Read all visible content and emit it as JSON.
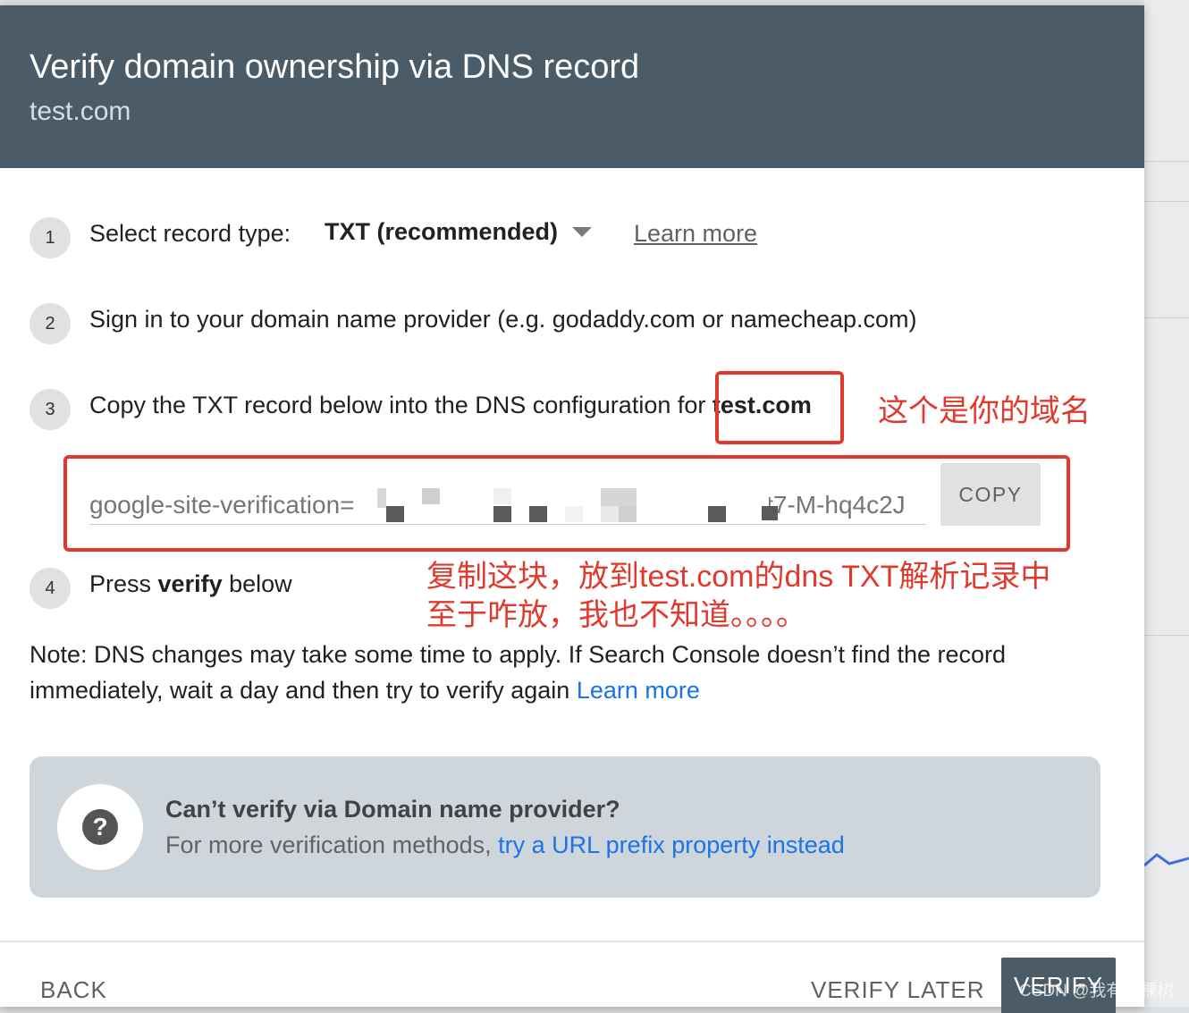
{
  "dialog": {
    "title": "Verify domain ownership via DNS record",
    "subtitle": "test.com"
  },
  "steps": [
    {
      "number": "1",
      "label": "Select record type:"
    },
    {
      "number": "2",
      "label": "Sign in to your domain name provider (e.g. godaddy.com or namecheap.com)"
    },
    {
      "number": "3",
      "label": "Copy the TXT record below into the DNS configuration for ",
      "domain": "test.com"
    },
    {
      "number": "4",
      "label_pre": "Press ",
      "label_bold": "verify",
      "label_post": " below"
    }
  ],
  "record_type": {
    "selected": "TXT (recommended)",
    "learn_more": "Learn more"
  },
  "txt_record": {
    "prefix": "google-site-verification=",
    "visible_suffix": "3t7-M-hq4c2J",
    "copy_label": "COPY"
  },
  "note": {
    "text": "Note: DNS changes may take some time to apply. If Search Console doesn’t find the record immediately, wait a day and then try to verify again ",
    "link": "Learn more"
  },
  "help": {
    "icon": "question-icon",
    "title": "Can’t verify via Domain name provider?",
    "body": "For more verification methods, ",
    "link": "try a URL prefix property instead"
  },
  "footer": {
    "back": "BACK",
    "verify_later": "VERIFY LATER",
    "verify": "VERIFY"
  },
  "annotations": {
    "domain_note": "这个是你的域名",
    "copy_note_line1": "复制这块，放到test.com的dns TXT解析记录中",
    "copy_note_line2": "至于咋放，我也不知道。。。。"
  },
  "watermark": "CSDN @我有一棵树",
  "colors": {
    "header": "#4b5b67",
    "annotation": "#e03a2e",
    "link": "#1a73e8"
  }
}
